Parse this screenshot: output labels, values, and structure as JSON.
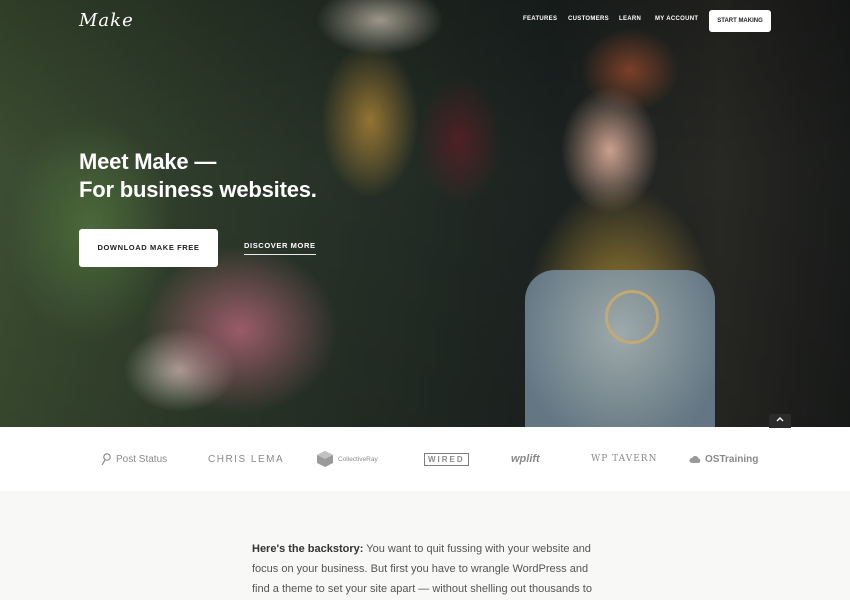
{
  "header": {
    "logo": "Make",
    "nav": [
      {
        "label": "FEATURES"
      },
      {
        "label": "CUSTOMERS"
      },
      {
        "label": "LEARN"
      },
      {
        "label": "MY ACCOUNT"
      }
    ],
    "cta": "START MAKING"
  },
  "hero": {
    "headline_line1": "Meet Make —",
    "headline_line2": "For business websites.",
    "primary_button": "DOWNLOAD MAKE FREE",
    "secondary_link": "DISCOVER MORE",
    "scroll_top_icon": "chevron-up-icon"
  },
  "brands": [
    {
      "name": "Post Status",
      "icon": "link-icon"
    },
    {
      "name": "CHRIS LEMA"
    },
    {
      "name": "CollectiveRay",
      "icon": "cube-icon"
    },
    {
      "name": "WIRED"
    },
    {
      "name": "wplift"
    },
    {
      "name": "WP TAVERN"
    },
    {
      "name": "OSTraining",
      "icon": "cloud-icon"
    }
  ],
  "story": {
    "lead": "Here's the backstory:",
    "body": " You want to quit fussing with your website and focus on your business. But first you have to wrangle WordPress and find a theme to set your site apart — without shelling out thousands to hire a"
  },
  "colors": {
    "hero_text": "#ffffff",
    "strip_bg": "#ffffff",
    "story_bg": "#f8f8f7",
    "brand_gray": "#8a8a8a"
  }
}
